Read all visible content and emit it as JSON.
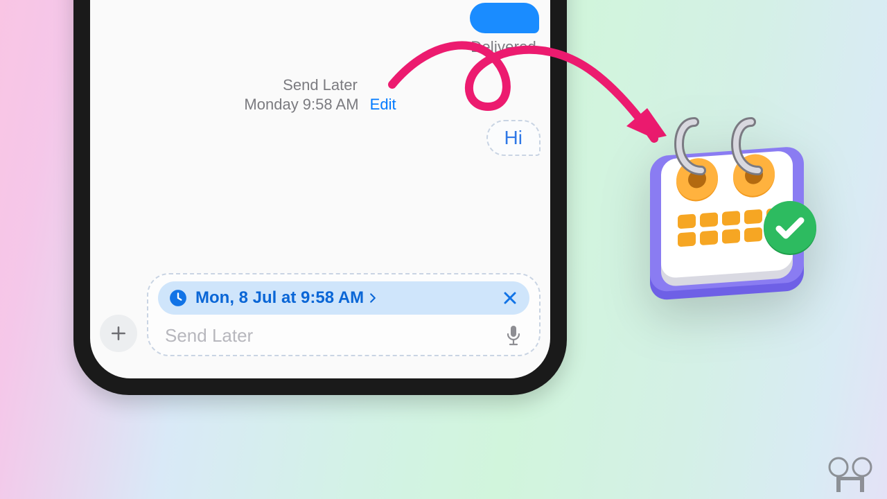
{
  "messages": {
    "sent_bubble_text": "",
    "delivered_label": "Delivered",
    "send_later_title": "Send Later",
    "send_later_time": "Monday 9:58 AM",
    "edit_label": "Edit",
    "pending_bubble_text": "Hi"
  },
  "compose": {
    "schedule_label": "Mon, 8 Jul at 9:58 AM",
    "placeholder": "Send Later"
  },
  "colors": {
    "imessage_blue": "#1a8cff",
    "link_blue": "#007aff",
    "pill_bg": "#cfe5fb",
    "pill_text": "#0a66d6",
    "accent_pink": "#ec1b6f",
    "check_green": "#24b558"
  }
}
